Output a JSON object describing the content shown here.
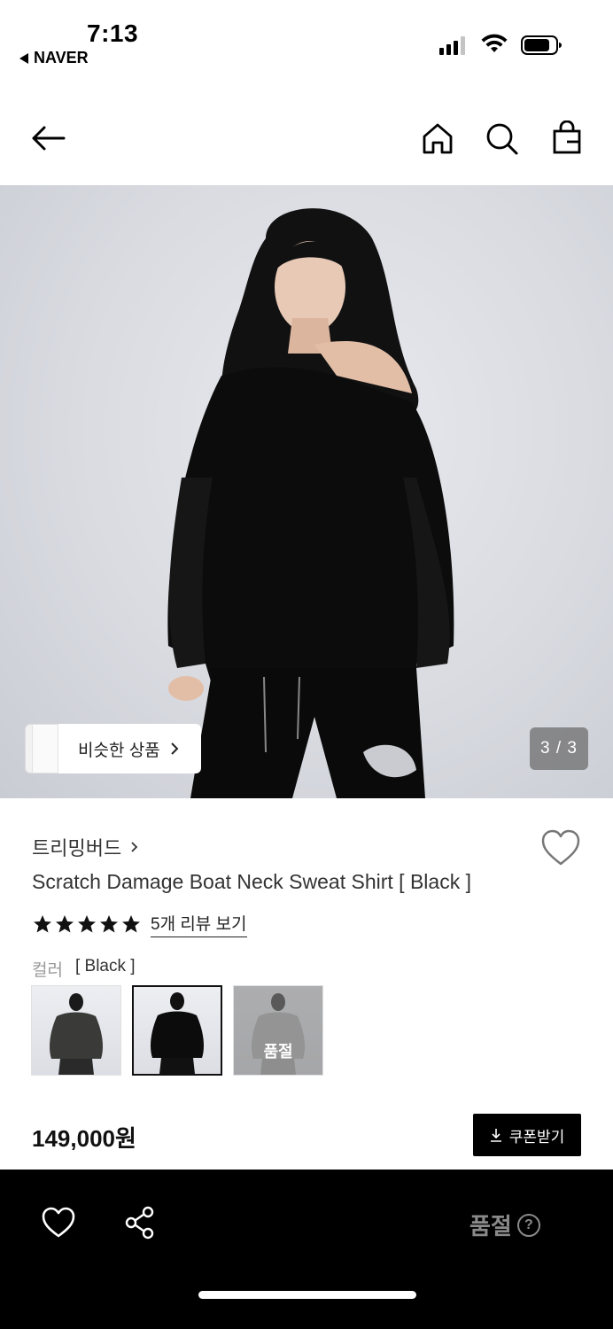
{
  "status_bar": {
    "time": "7:13",
    "back_app": "NAVER"
  },
  "nav": {
    "back_icon": "arrow-left-icon",
    "home_icon": "home-icon",
    "search_icon": "search-icon",
    "cart_icon": "shopping-bag-icon"
  },
  "hero": {
    "similar_label": "비슷한 상품",
    "pager": "3 / 3",
    "background": "#dcdee3"
  },
  "product": {
    "brand": "트리밍버드",
    "title": "Scratch Damage Boat Neck Sweat Shirt [ Black ]",
    "stars": 5,
    "review_link": "5개 리뷰 보기",
    "color_label": "컬러",
    "color_value": "[ Black ]",
    "swatches": [
      {
        "name": "Charcoal",
        "selected": false,
        "sold_out": false
      },
      {
        "name": "Black",
        "selected": true,
        "sold_out": false
      },
      {
        "name": "Grey",
        "selected": false,
        "sold_out": true,
        "badge": "품절"
      }
    ],
    "price": "149,000원",
    "coupon_label": "쿠폰받기"
  },
  "bottom_bar": {
    "soldout_label": "품절",
    "help_mark": "?",
    "background": "#000000"
  }
}
